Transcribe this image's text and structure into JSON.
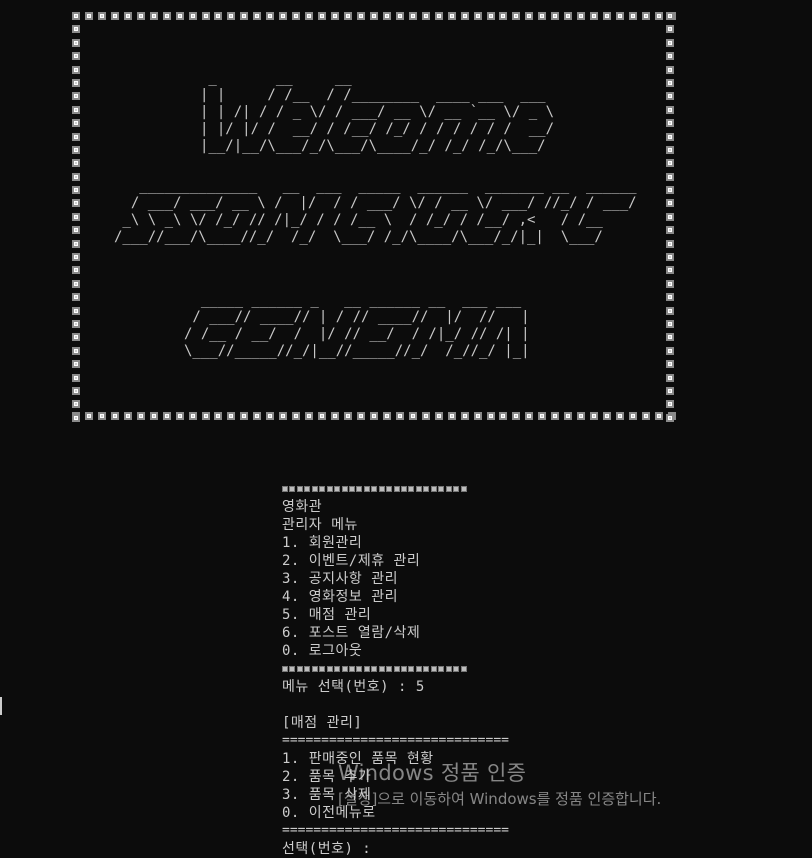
{
  "banner": {
    "ascii_welcome": " _       __     __\n| |     / /__  / /________  ____ ___  ___\n| | /| / / _ \\/ / ___/ __ \\/ __ `__ \\/ _ \\\n| |/ |/ /  __/ / /__/ /_/ / / / / / /  __/\n|__/|__/\\___/_/\\___/\\____/_/ /_/ /_/\\___/",
    "ascii_line2": "   ______________   __  ___  _____  ______  _______ __  ______\n  / ___/ ___/ __ \\ /  |/  / / ___/ \\/ / __ \\/ ___/ //_/ / ___/\n _\\ \\ _\\ \\/ /_/ // /|_/ / / /__ \\  / /_/ / /__/ ,<   / /__\n/___//___/\\____//_/  /_/  \\___/ /_/\\____/\\___/_/|_|  \\___/",
    "ascii_line3": "  _____ ______ _   __ ______ __  ___ ___\n / ___// ____// | / // ____//  |/  //   |\n/ /__ / __/  /  |/ // __/  / /|_/ // /| |\n\\___//_____//_/|__//_____//_/  /_//_/ |_|"
  },
  "menu": {
    "theater": "영화관",
    "admin_title": "관리자 메뉴",
    "items": [
      "1. 회원관리",
      "2. 이벤트/제휴 관리",
      "3. 공지사항 관리",
      "4. 영화정보 관리",
      "5. 매점 관리",
      "6. 포스트 열람/삭제",
      "0. 로그아웃"
    ],
    "prompt": "메뉴 선택(번호) : 5"
  },
  "submenu": {
    "title": "[매점 관리]",
    "separator": "=============================",
    "items": [
      "1. 판매중인 품목 현황",
      "2. 품목 추가",
      "3. 품목 삭제",
      "0. 이전메뉴로"
    ],
    "prompt": "선택(번호) :"
  },
  "watermark": {
    "title": "Windows 정품 인증",
    "subtitle": "[설정]으로 이동하여 Windows를 정품 인증합니다."
  },
  "colors": {
    "background": "#0c0c0c",
    "text": "#cccccc"
  }
}
